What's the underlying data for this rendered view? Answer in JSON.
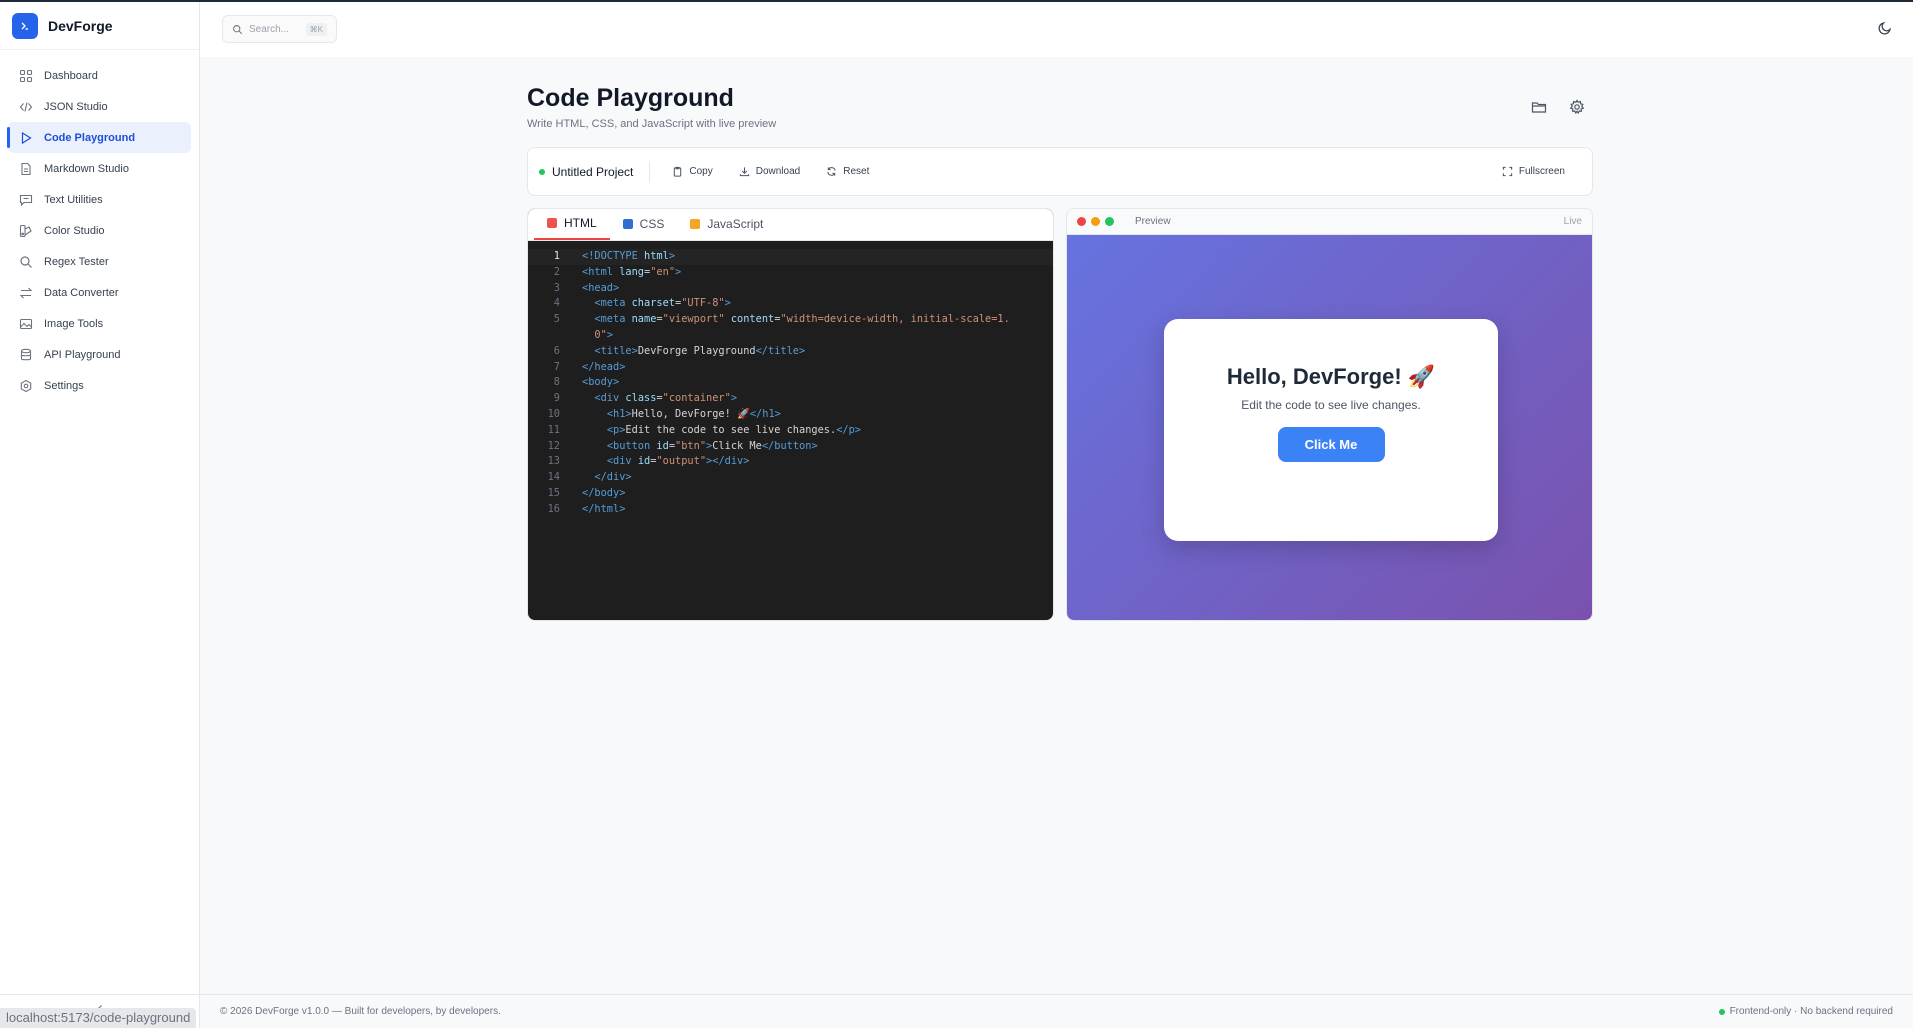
{
  "app": {
    "name": "DevForge"
  },
  "sidebar": {
    "items": [
      {
        "label": "Dashboard",
        "icon": "grid-icon"
      },
      {
        "label": "JSON Studio",
        "icon": "code-icon"
      },
      {
        "label": "Code Playground",
        "icon": "play-icon",
        "active": true
      },
      {
        "label": "Markdown Studio",
        "icon": "file-text-icon"
      },
      {
        "label": "Text Utilities",
        "icon": "message-square-icon"
      },
      {
        "label": "Color Studio",
        "icon": "palette-icon"
      },
      {
        "label": "Regex Tester",
        "icon": "search-icon"
      },
      {
        "label": "Data Converter",
        "icon": "arrows-swap-icon"
      },
      {
        "label": "Image Tools",
        "icon": "image-icon"
      },
      {
        "label": "API Playground",
        "icon": "database-icon"
      },
      {
        "label": "Settings",
        "icon": "gear-icon"
      }
    ],
    "collapse_icon": "chevron-left-icon"
  },
  "status_url": "localhost:5173/code-playground",
  "search": {
    "placeholder": "Search...",
    "shortcut": "⌘K"
  },
  "page": {
    "title": "Code Playground",
    "subtitle": "Write HTML, CSS, and JavaScript with live preview"
  },
  "toolbar": {
    "project_name": "Untitled Project",
    "copy": "Copy",
    "download": "Download",
    "reset": "Reset",
    "fullscreen": "Fullscreen"
  },
  "editor": {
    "tabs": [
      {
        "label": "HTML",
        "color": "#ef5350"
      },
      {
        "label": "CSS",
        "color": "#2f6fd1"
      },
      {
        "label": "JavaScript",
        "color": "#f5a623"
      }
    ],
    "active_tab": "HTML",
    "lines": [
      {
        "n": "1",
        "html": "<span class=\"tg\">&lt;!DOCTYPE</span> <span class=\"at\">html</span><span class=\"tg\">&gt;</span>"
      },
      {
        "n": "2",
        "html": "<span class=\"tg\">&lt;html</span> <span class=\"at\">lang</span>=<span class=\"st\">\"en\"</span><span class=\"tg\">&gt;</span>"
      },
      {
        "n": "3",
        "html": "<span class=\"tg\">&lt;head&gt;</span>"
      },
      {
        "n": "4",
        "html": "  <span class=\"tg\">&lt;meta</span> <span class=\"at\">charset</span>=<span class=\"st\">\"UTF-8\"</span><span class=\"tg\">&gt;</span>"
      },
      {
        "n": "5",
        "html": "  <span class=\"tg\">&lt;meta</span> <span class=\"at\">name</span>=<span class=\"st\">\"viewport\"</span> <span class=\"at\">content</span>=<span class=\"st\">\"width=device-width, initial-scale=1.</span>"
      },
      {
        "n": "",
        "html": "  <span class=\"st\">0\"</span><span class=\"tg\">&gt;</span>"
      },
      {
        "n": "6",
        "html": "  <span class=\"tg\">&lt;title&gt;</span><span class=\"tx\">DevForge Playground</span><span class=\"tg\">&lt;/title&gt;</span>"
      },
      {
        "n": "7",
        "html": "<span class=\"tg\">&lt;/head&gt;</span>"
      },
      {
        "n": "8",
        "html": "<span class=\"tg\">&lt;body&gt;</span>"
      },
      {
        "n": "9",
        "html": "  <span class=\"tg\">&lt;div</span> <span class=\"at\">class</span>=<span class=\"st\">\"container\"</span><span class=\"tg\">&gt;</span>"
      },
      {
        "n": "10",
        "html": "    <span class=\"tg\">&lt;h1&gt;</span><span class=\"tx\">Hello, DevForge! 🚀</span><span class=\"tg\">&lt;/h1&gt;</span>"
      },
      {
        "n": "11",
        "html": "    <span class=\"tg\">&lt;p&gt;</span><span class=\"tx\">Edit the code to see live changes.</span><span class=\"tg\">&lt;/p&gt;</span>"
      },
      {
        "n": "12",
        "html": "    <span class=\"tg\">&lt;button</span> <span class=\"at\">id</span>=<span class=\"st\">\"btn\"</span><span class=\"tg\">&gt;</span><span class=\"tx\">Click Me</span><span class=\"tg\">&lt;/button&gt;</span>"
      },
      {
        "n": "13",
        "html": "    <span class=\"tg\">&lt;div</span> <span class=\"at\">id</span>=<span class=\"st\">\"output\"</span><span class=\"tg\">&gt;&lt;/div&gt;</span>"
      },
      {
        "n": "14",
        "html": "  <span class=\"tg\">&lt;/div&gt;</span>"
      },
      {
        "n": "15",
        "html": "<span class=\"tg\">&lt;/body&gt;</span>"
      },
      {
        "n": "16",
        "html": "<span class=\"tg\">&lt;/html&gt;</span>"
      }
    ]
  },
  "preview": {
    "title": "Preview",
    "status": "Live",
    "heading": "Hello, DevForge! 🚀",
    "text": "Edit the code to see live changes.",
    "button": "Click Me"
  },
  "footer": {
    "left": "© 2026 DevForge v1.0.0 — Built for developers, by developers.",
    "right": "Frontend-only · No backend required"
  },
  "colors": {
    "accent": "#2563eb",
    "status_green": "#22c55e",
    "preview_gradient_start": "#6673e0",
    "preview_gradient_end": "#7a52ad"
  }
}
